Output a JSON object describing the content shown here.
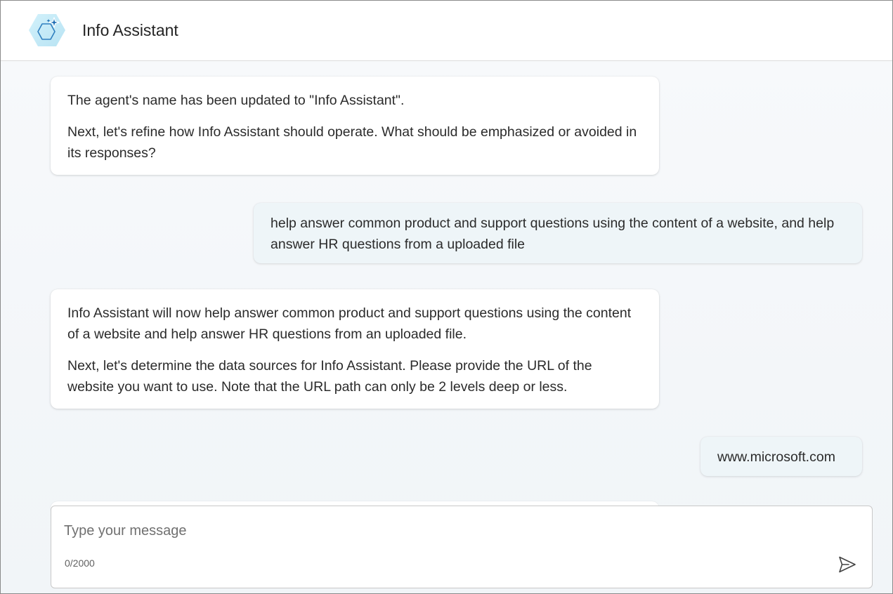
{
  "app": {
    "title": "Info Assistant",
    "logo_icon": "sparkle-hexagon-icon",
    "accent_color": "#0f6cbd",
    "logo_bg_color": "#c7ecf7"
  },
  "messages": [
    {
      "role": "assistant",
      "paragraphs": [
        "The agent's name has been updated to \"Info Assistant\".",
        "Next, let's refine how Info Assistant should operate. What should be emphasized or avoided in its responses?"
      ]
    },
    {
      "role": "user",
      "text": "help answer common product and support questions using the content of a website, and help answer HR questions from a uploaded file"
    },
    {
      "role": "assistant",
      "paragraphs": [
        "Info Assistant will now help answer common product and support questions using the content of a website and help answer HR questions from an uploaded file.",
        "Next, let's determine the data sources for Info Assistant. Please provide the URL of the website you want to use. Note that the URL path can only be 2 levels deep or less."
      ]
    },
    {
      "role": "user",
      "text": "www.microsoft.com"
    }
  ],
  "composer": {
    "placeholder": "Type your message",
    "value": "",
    "char_count": "0/2000",
    "send_icon": "send-icon"
  }
}
